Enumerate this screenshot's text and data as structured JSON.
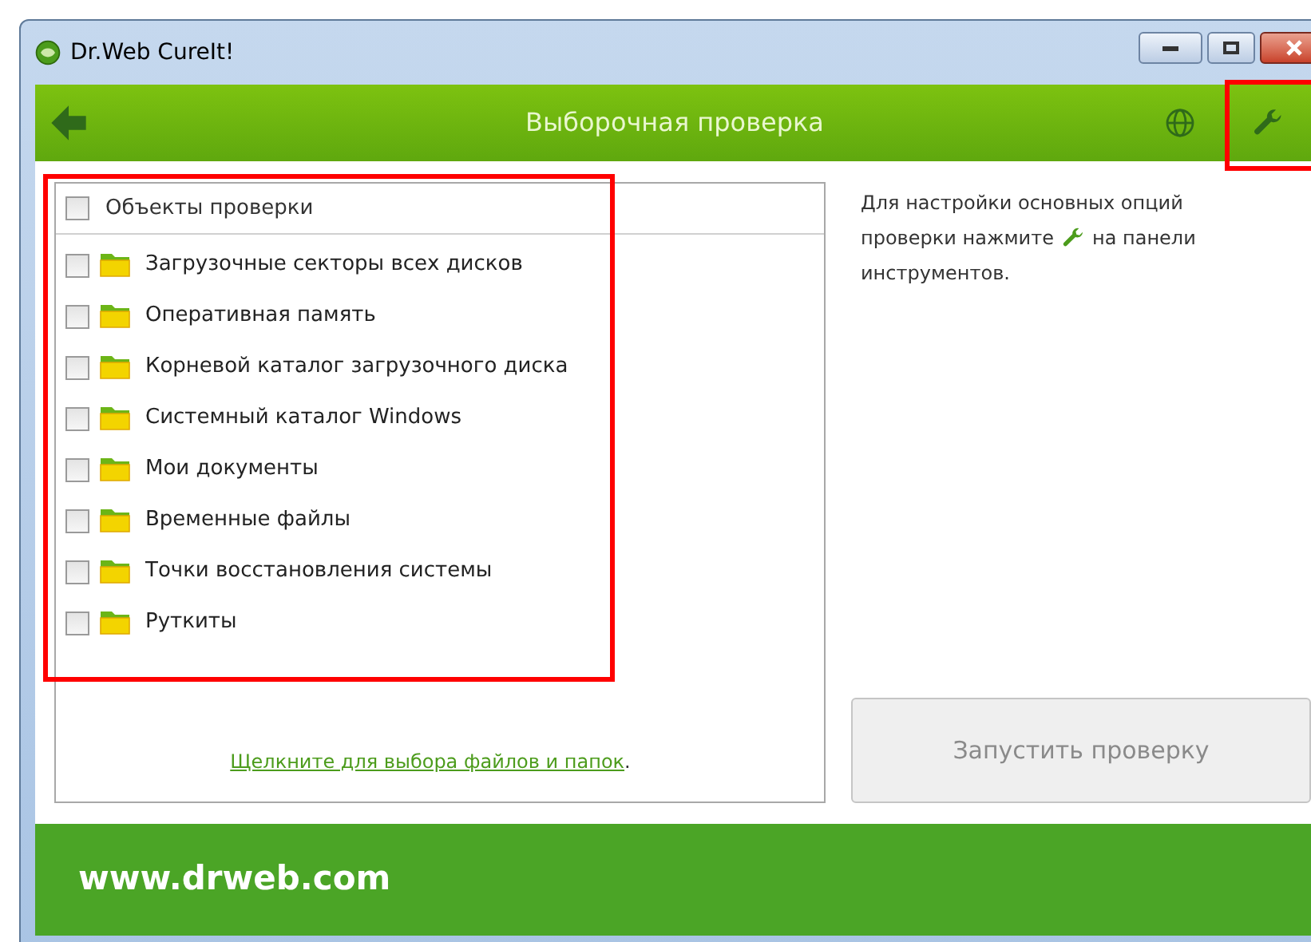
{
  "window": {
    "title": "Dr.Web CureIt!"
  },
  "header": {
    "title": "Выборочная проверка"
  },
  "objects": {
    "header": {
      "label": "Объекты проверки",
      "checked": false
    },
    "items": [
      {
        "label": "Загрузочные секторы всех дисков",
        "checked": false
      },
      {
        "label": "Оперативная память",
        "checked": false
      },
      {
        "label": "Корневой каталог загрузочного диска",
        "checked": false
      },
      {
        "label": "Системный каталог Windows",
        "checked": false
      },
      {
        "label": "Мои документы",
        "checked": false
      },
      {
        "label": "Временные файлы",
        "checked": false
      },
      {
        "label": "Точки восстановления системы",
        "checked": false
      },
      {
        "label": "Руткиты",
        "checked": false
      }
    ],
    "link": "Щелкните для выбора файлов и папок",
    "link_suffix": "."
  },
  "hint": {
    "line_1": "Для настройки основных опций",
    "line_2_before": "проверки нажмите",
    "line_2_after": "на панели",
    "line_3": "инструментов."
  },
  "start_button": {
    "label": "Запустить проверку",
    "disabled": true
  },
  "footer": {
    "url": "www.drweb.com"
  }
}
